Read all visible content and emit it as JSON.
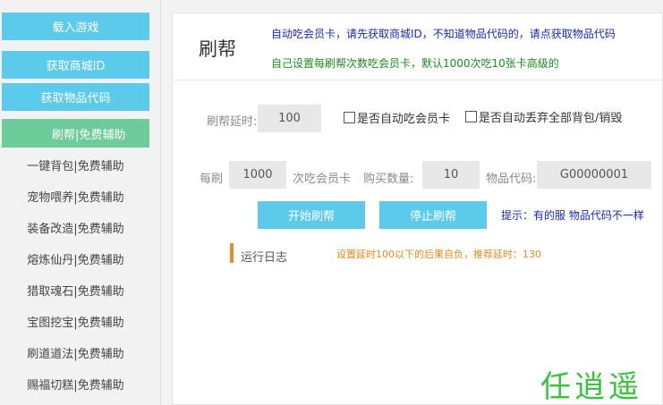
{
  "sidebar": {
    "buttons": [
      {
        "label": "载入游戏"
      },
      {
        "label": "获取商城ID"
      },
      {
        "label": "获取物品代码"
      }
    ],
    "items": [
      {
        "label": "刷帮|免费辅助",
        "active": true
      },
      {
        "label": "一键背包|免费辅助"
      },
      {
        "label": "宠物喂养|免费辅助"
      },
      {
        "label": "装备改造|免费辅助"
      },
      {
        "label": "熔炼仙丹|免费辅助"
      },
      {
        "label": "猎取魂石|免费辅助"
      },
      {
        "label": "宝图挖宝|免费辅助"
      },
      {
        "label": "刷道道法|免费辅助"
      },
      {
        "label": "赐福切糕|免费辅助"
      }
    ]
  },
  "main": {
    "title": "刷帮",
    "notice1": "自动吃会员卡，请先获取商城ID，不知道物品代码的，请点获取物品代码",
    "notice2": "自己设置每刷帮次数吃会员卡，默认1000次吃10张卡高级的",
    "delay": {
      "label": "刷帮延时:",
      "value": "100"
    },
    "auto_card": {
      "label": "是否自动吃会员卡",
      "checked": false
    },
    "auto_discard": {
      "label": "是否自动丢弃全部背包/销毁",
      "checked": false
    },
    "per_label": "每刷",
    "per_value": "1000",
    "per_suffix": "次吃会员卡",
    "qty": {
      "label": "购买数量:",
      "value": "10"
    },
    "code": {
      "label": "物品代码:",
      "value": "G00000001"
    },
    "start_button": "开始刷帮",
    "stop_button": "停止刷帮",
    "hint": "提示：有的服 物品代码不一样",
    "log_title": "运行日志",
    "log_warning": "设置延时100以下的后果自负，推荐延时：130"
  },
  "logo": "任逍遥",
  "colors": {
    "accent_blue": "#5ccbeb",
    "active_green": "#6ecb9a",
    "notice_blue": "#1a27b5",
    "notice_green": "#1e8a1e",
    "warn_orange": "#e8881a"
  }
}
